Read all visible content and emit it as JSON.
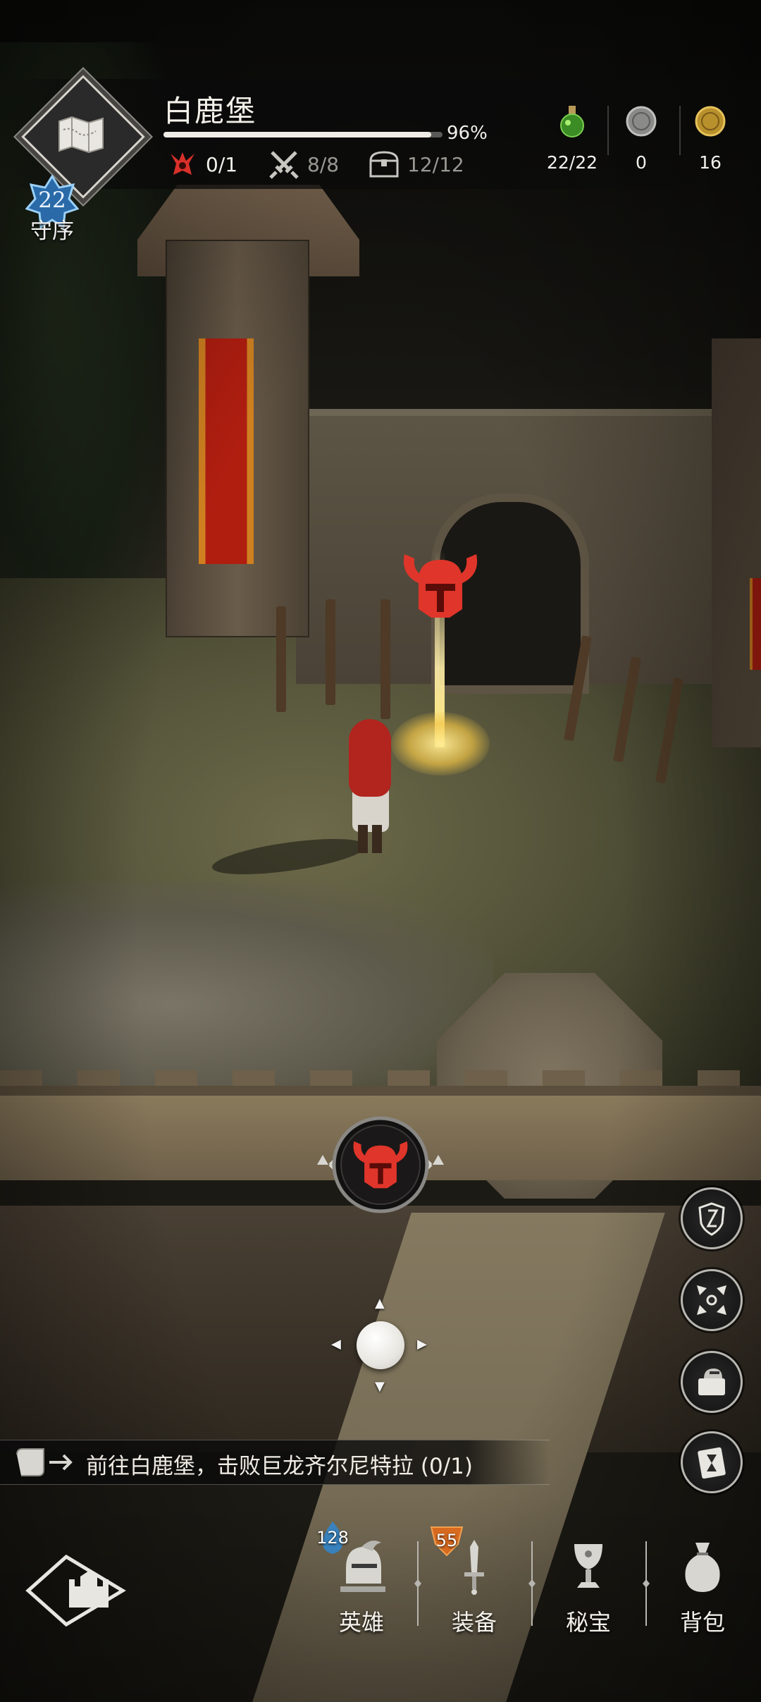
{
  "hud": {
    "area_name": "白鹿堡",
    "exploration_progress": 0.96,
    "exploration_text": "96%",
    "rank_level": "22",
    "rank_label": "守序",
    "stats": {
      "bosses": "0/1",
      "battles": "8/8",
      "chests": "12/12"
    },
    "resources": [
      {
        "icon": "green-potion-icon",
        "value": "22/22"
      },
      {
        "icon": "silver-coin-icon",
        "value": "0"
      },
      {
        "icon": "gold-coin-icon",
        "value": "16"
      }
    ]
  },
  "world": {
    "enemy_marker_icon": "horned-helmet-icon",
    "enemy_button_icon": "horned-helmet-icon"
  },
  "side_buttons": [
    {
      "icon": "shield-badge-icon"
    },
    {
      "icon": "expand-arrows-icon"
    },
    {
      "icon": "helmet-book-icon"
    },
    {
      "icon": "hourglass-book-icon"
    }
  ],
  "quest": {
    "text": "前往白鹿堡，击败巨龙齐尔尼特拉 (0/1)"
  },
  "nav": {
    "heroes": {
      "label": "英雄",
      "badge": "128"
    },
    "equipment": {
      "label": "装备",
      "badge": "55"
    },
    "treasure": {
      "label": "秘宝"
    },
    "bag": {
      "label": "背包"
    }
  },
  "colors": {
    "enemy_red": "#e0352a",
    "hud_bg": "#0a0a0a",
    "text_light": "#f4f1ea",
    "badge_blue": "#3aa0e0",
    "badge_orange": "#d86a20"
  }
}
